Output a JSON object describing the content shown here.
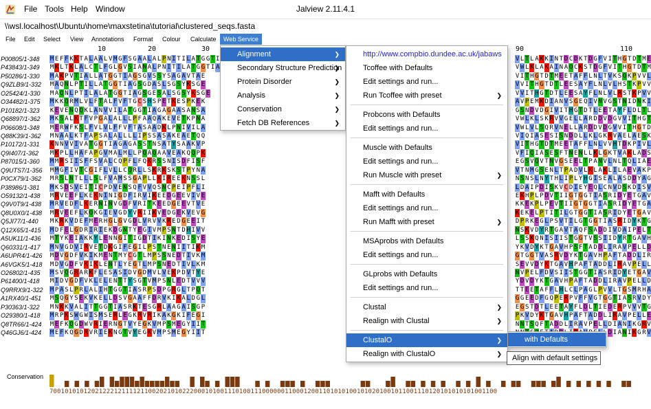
{
  "titlebar": {
    "menus": [
      "File",
      "Tools",
      "Help",
      "Window"
    ],
    "title": "Jalview 2.11.4.1"
  },
  "pathbar": {
    "path": "\\\\wsl.localhost\\Ubuntu\\home\\maxstetina\\tutorial\\clustered_seqs.fasta"
  },
  "menubar": {
    "items": [
      "File",
      "Edit",
      "Select",
      "View",
      "Annotations",
      "Format",
      "Colour",
      "Calculate",
      "Web Service"
    ],
    "active_index": 8
  },
  "ruler": {
    "labels": [
      "10",
      "20",
      "30",
      "90",
      "110"
    ]
  },
  "sequences": [
    {
      "id": "P00805/1-348",
      "seq": "MEFFKKTALAALVMGFSGAALALPNITILATGGTIAG"
    },
    {
      "id": "P43843/1-349",
      "seq": "MKLTKLALCTLFGLGVSIANALPNITILATGGTIAG"
    },
    {
      "id": "P50286/1-330",
      "seq": "MAKPVTIALLATGGTIAGSGVSSYSAGAVTAE"
    },
    {
      "id": "Q9ZLB9/1-332",
      "seq": "MAQNLPTILLATGGTIAGSGDASLSGSYKSGE"
    },
    {
      "id": "O25424/1-330",
      "seq": "MAQNLPTILALATGGTIAGSGESALSGSYKSGE"
    },
    {
      "id": "O34482/1-375",
      "seq": "MKKQRMLVLFTALFVFTGCSHSPETKESPKEK"
    },
    {
      "id": "P10182/1-323",
      "seq": "KEVENQQKLANVVILATGGTIAGAGAASANSA"
    },
    {
      "id": "Q68897/1-362",
      "seq": "MKSALKTFVPGALALLLPFAAQAKEVETKPNA"
    },
    {
      "id": "P06608/1-348",
      "seq": "MERWFKSLFVLVLFFVFTASAADKLPNIVILA"
    },
    {
      "id": "Q88K39/1-362",
      "seq": "MNAALKTFAPSALALLLLIPSSASAKEAETQQ"
    },
    {
      "id": "P10172/1-331",
      "seq": "KNNVVIVATGGTIAGAGASSTNSATYSAAKVP"
    },
    {
      "id": "Q9I407/1-362",
      "seq": "MKPLLHAFAPGVMALMLLPQAQAAVEAKQQPK"
    },
    {
      "id": "P87015/1-360",
      "seq": "MMRSIISFFSVALCQPFLFQKRSSNISDFISF"
    },
    {
      "id": "Q9UTS7/1-356",
      "seq": "MMGFIVTCGIFLVLLCQRLLSKRKSKSTPYNA"
    },
    {
      "id": "P0CX79/1-362",
      "seq": "MRSLNTLLLSLFVAMSSGAPLLKIREEKNSSL"
    },
    {
      "id": "P38986/1-381",
      "seq": "MKSDSVEITICPDVENSQFVVQSNCPEIPFLI"
    },
    {
      "id": "O59132/1-438",
      "seq": "MRVEEFLKEKNINIGDFIRVIKEEDGEEVIVE"
    },
    {
      "id": "Q9V0T9/1-438",
      "seq": "MRVEDFLKERNINVGDFVRITKEEDGEEVTVE"
    },
    {
      "id": "Q8U0X0/1-438",
      "seq": "MRVEEFLKQKGIEVGDYVRIIKVEDGEKVEVG"
    },
    {
      "id": "Q5JI77/1-440",
      "seq": "MKRKVDEFMERHGLGVGDLVRVVKREDGEEIT"
    },
    {
      "id": "Q12X65/1-415",
      "seq": "MDFELGDRIRIEKDGNTYEGIVMPSNTDHIVV"
    },
    {
      "id": "A5UK11/1-436",
      "seq": "MTYKEIAKKYLENNGITIGDTIKINKEDISYE"
    },
    {
      "id": "Q60331/1-417",
      "seq": "MNVGDVIRVETDKGIFEGILPSTNENIITIKM"
    },
    {
      "id": "A6UPR4/1-426",
      "seq": "MDVGDFVKIKMENTMYCGTLMPSSNEDTIVKM"
    },
    {
      "id": "A6VGK5/1-418",
      "seq": "MDVGDFVKIKLENTLYEGTLMPSNEDTIVLKM"
    },
    {
      "id": "O26802/1-435",
      "seq": "MSVQGRARKFLESASIDVGDMVLVEKPDVTYE"
    },
    {
      "id": "P61400/1-418",
      "seq": "MIDVGDFVKLELENTTYSGTVMPSNLEDTVVV"
    },
    {
      "id": "Q9RRX9/1-322",
      "seq": "MPASLPRLALIHTGGTIASRPSDPGRGLTPQT"
    },
    {
      "id": "A1RX40/1-451",
      "seq": "MSQGYSEKVKELLDSVGAAFFDRVKIKALDGL"
    },
    {
      "id": "P30363/1-322",
      "seq": "MNKKVALITTGGTIASRKTESGRLAAGAISGP"
    },
    {
      "id": "O29380/1-418",
      "seq": "MRPKSWGWISMSERLEGKRVRIKAKGKIFEGI"
    },
    {
      "id": "Q8TR66/1-424",
      "seq": "MEFKQGDWVRIERNGTVYEGKVMPSMEGYIIT"
    },
    {
      "id": "Q46GJ6/1-424",
      "seq": "MEFKQGDRVRIEKNGTVYEGKVMPSMEGYIIT"
    }
  ],
  "right_sequences": [
    {
      "seq": "VLTLAKKINTDCDKTDGFVITHGTDTME"
    },
    {
      "seq": "VWLKLAKAINAQCKSTDGFVITHGTDTM"
    },
    {
      "seq": "VITHGTDTMEETAFFLNLTVKSQKPVVL"
    },
    {
      "seq": "VVITHGTDTLEESAYFLNLVLHSTKPVV"
    },
    {
      "seq": "VVITHGTDTLEESAYFLNLVLRSTKPVV"
    },
    {
      "seq": "AVPEMKDIANVSGEQIVNVGSTNIDNKI"
    },
    {
      "seq": "GSNDVDGIVITHGTDTLEETAYFLDLTL"
    },
    {
      "seq": "VWLKLSKRVVGELLARDDVDGVVITHGT"
    },
    {
      "seq": "VWLVLSQRVNELLARDDVDGVVITHGTD"
    },
    {
      "seq": "VIQIASESISNDDLLKLGKRVAELAESK"
    },
    {
      "seq": "VITHGTDTMEETAFFLNLVVHTDKPIVL"
    },
    {
      "seq": "VFIQIASESFTNENLLKLGKTVAKLADS"
    },
    {
      "seq": "EGSVQVTNVGSEELTPANVLNLTQLIAE"
    },
    {
      "seq": "VTNMGSENLTPADVLKLAKLILAEVAKP"
    },
    {
      "seq": "NSNSLNYTHLIPLYHGISEALASDDYAG"
    },
    {
      "seq": "LDAIPDISKVCDIEYEQLCNVDSKDISV"
    },
    {
      "seq": "EKHPLPDVTIIGTGGTIASRIDYETGAV"
    },
    {
      "seq": "KKEKPLPEVTIIGTGGTIASRIDYETGA"
    },
    {
      "seq": "KEKELPTITILGTGGTIASRIDYETGAV"
    },
    {
      "seq": "DPRKEGLPSVTILGTGGTIASRIDYKTG"
    },
    {
      "seq": "NSKVDYRTGAVTAQFSADDIVDAIPELT"
    },
    {
      "seq": "LSSKQNISIISTGGTVSSIIDYRTGAVH"
    },
    {
      "seq": "YKVDYKTGAVHPSFTADDLIRAVPELLD"
    },
    {
      "seq": "GTGGTVASRVDYKTGAVHPAFTADDLIR"
    },
    {
      "seq": "SEVVDYKTGAVHPAFTADDLIRAVPELL"
    },
    {
      "seq": "NVPELFDVSIISTGGTIASRIDYETGAV"
    },
    {
      "seq": "YDVDYKTGAVHPAFTADDLIRAVPELLD"
    },
    {
      "seq": "TTEETAFFLHLCLPAGLPVVLTGSMRHA"
    },
    {
      "seq": "GGEEDFGQPERPVFFVGTGGTIASRVDY"
    },
    {
      "seq": "EGSTDTLEETAYFLDLTIEDERPVVVTG"
    },
    {
      "seq": "PKVDYKTGAVHPAFTADDLIRAVPELLE"
    },
    {
      "seq": "NNTSQFTADDLIRAVPELLDIANIKGRV"
    },
    {
      "seq": "NNTSQFTADDLIRAVPELLDIANIKGRV"
    }
  ],
  "conservation": {
    "label": "Conservation",
    "scores": "7001010101202122212111121100202101022200010100111010011100000011000120011010101001010201001011001110120101010101001100"
  },
  "ws_menu": {
    "items": [
      "Alignment",
      "Secondary Structure Prediction",
      "Protein Disorder",
      "Analysis",
      "Conservation",
      "Fetch DB References"
    ],
    "highlight_index": 0
  },
  "alignment_menu": {
    "url": "http://www.compbio.dundee.ac.uk/jabaws",
    "items": [
      "Tcoffee  with Defaults",
      "Edit settings and run...",
      "Run Tcoffee  with preset",
      "Probcons  with Defaults",
      "Edit settings and run...",
      "Muscle  with Defaults",
      "Edit settings and run...",
      "Run Muscle  with preset",
      "Mafft  with Defaults",
      "Edit settings and run...",
      "Run Mafft  with preset",
      "MSAprobs  with Defaults",
      "Edit settings and run...",
      "GLprobs  with Defaults",
      "Edit settings and run...",
      "Clustal",
      "Realign with Clustal",
      "ClustalO",
      "Realign with ClustalO"
    ],
    "highlight_index": 17
  },
  "clustalo_menu": {
    "items": [
      "with Defaults"
    ],
    "highlight_index": 0
  },
  "tooltip": {
    "text": "Align  with default settings"
  },
  "colors": {
    "accent": "#2f6fc7",
    "menu_active": "#3d7fd1",
    "hydrophobic": "#80a0f0",
    "glycine": "#f09048",
    "proline": "#c0c000",
    "polar": "#15c015",
    "cysteine": "#f08080",
    "aromatic": "#15a4a4",
    "acidic": "#c048c0",
    "basic": "#f01505",
    "conservation_bar": "#7a3a10"
  }
}
